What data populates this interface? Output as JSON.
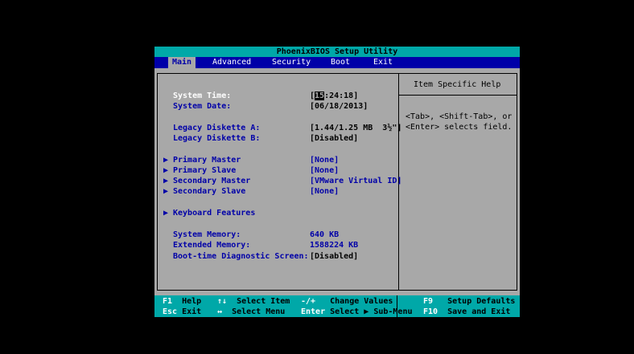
{
  "title": "PhoenixBIOS Setup Utility",
  "menu": [
    {
      "label": "Main",
      "active": true
    },
    {
      "label": "Advanced",
      "active": false
    },
    {
      "label": "Security",
      "active": false
    },
    {
      "label": "Boot",
      "active": false
    },
    {
      "label": "Exit",
      "active": false
    }
  ],
  "settings": {
    "system_time": {
      "label": "System Time:",
      "hour": "15",
      "rest": ":24:18]",
      "open": "["
    },
    "system_date": {
      "label": "System Date:",
      "value": "[06/18/2013]"
    },
    "legacy_a": {
      "label": "Legacy Diskette A:",
      "value": "[1.44/1.25 MB  3½\"]"
    },
    "legacy_b": {
      "label": "Legacy Diskette B:",
      "value": "[Disabled]"
    },
    "primary_master": {
      "label": "Primary Master",
      "value": "[None]"
    },
    "primary_slave": {
      "label": "Primary Slave",
      "value": "[None]"
    },
    "secondary_master": {
      "label": "Secondary Master",
      "value": "[VMware Virtual ID]"
    },
    "secondary_slave": {
      "label": "Secondary Slave",
      "value": "[None]"
    },
    "keyboard": {
      "label": "Keyboard Features"
    },
    "system_memory": {
      "label": "System Memory:",
      "value": "640 KB"
    },
    "extended_memory": {
      "label": "Extended Memory:",
      "value": "1588224 KB"
    },
    "boot_diag": {
      "label": "Boot-time Diagnostic Screen:",
      "value": "[Disabled]"
    },
    "submenu_arrow": "▶"
  },
  "help": {
    "title": "Item Specific Help",
    "line1": "<Tab>, <Shift-Tab>, or",
    "line2": "<Enter> selects field."
  },
  "footer": {
    "row1": [
      {
        "key": "F1",
        "desc": "Help"
      },
      {
        "key": "↑↓",
        "desc": "Select Item"
      },
      {
        "key": "-/+",
        "desc": "Change Values"
      },
      {
        "key": "F9",
        "desc": "Setup Defaults"
      }
    ],
    "row2": [
      {
        "key": "Esc",
        "desc": "Exit"
      },
      {
        "key": "↔",
        "desc": "Select Menu"
      },
      {
        "key": "Enter",
        "desc": "Select ▶ Sub-Menu"
      },
      {
        "key": "F10",
        "desc": "Save and Exit"
      }
    ]
  }
}
